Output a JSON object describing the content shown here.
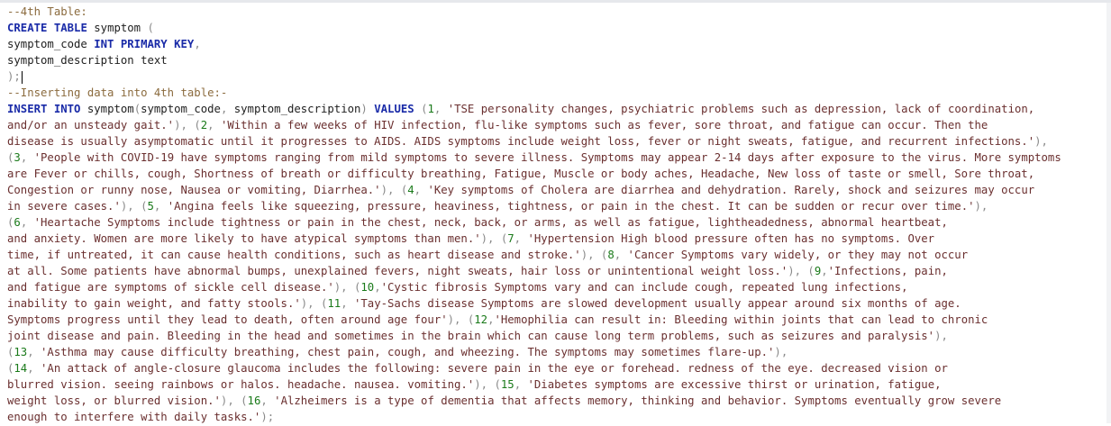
{
  "editor": {
    "lines": [
      "--4th Table:",
      "CREATE TABLE symptom (",
      "symptom_code INT PRIMARY KEY,",
      "symptom_description text",
      ");",
      "--Inserting data into 4th table:-",
      "INSERT INTO symptom(symptom_code, symptom_description) VALUES (1, 'TSE personality changes, psychiatric problems such as depression, lack of coordination,",
      "and/or an unsteady gait.'), (2, 'Within a few weeks of HIV infection, flu-like symptoms such as fever, sore throat, and fatigue can occur. Then the",
      "disease is usually asymptomatic until it progresses to AIDS. AIDS symptoms include weight loss, fever or night sweats, fatigue, and recurrent infections.'),",
      "(3, 'People with COVID-19 have symptoms ranging from mild symptoms to severe illness. Symptoms may appear 2-14 days after exposure to the virus. More symptoms",
      "are Fever or chills, cough, Shortness of breath or difficulty breathing, Fatigue, Muscle or body aches, Headache, New loss of taste or smell, Sore throat,",
      "Congestion or runny nose, Nausea or vomiting, Diarrhea.'), (4, 'Key symptoms of Cholera are diarrhea and dehydration. Rarely, shock and seizures may occur",
      "in severe cases.'), (5, 'Angina feels like squeezing, pressure, heaviness, tightness, or pain in the chest. It can be sudden or recur over time.'),",
      "(6, 'Heartache Symptoms include tightness or pain in the chest, neck, back, or arms, as well as fatigue, lightheadedness, abnormal heartbeat,",
      "and anxiety. Women are more likely to have atypical symptoms than men.'), (7, 'Hypertension High blood pressure often has no symptoms. Over",
      "time, if untreated, it can cause health conditions, such as heart disease and stroke.'), (8, 'Cancer Symptoms vary widely, or they may not occur",
      "at all. Some patients have abnormal bumps, unexplained fevers, night sweats, hair loss or unintentional weight loss.'), (9,'Infections, pain,",
      "and fatigue are symptoms of sickle cell disease.'), (10,'Cystic fibrosis Symptoms vary and can include cough, repeated lung infections,",
      "inability to gain weight, and fatty stools.'), (11, 'Tay-Sachs disease Symptoms are slowed development usually appear around six months of age.",
      "Symptoms progress until they lead to death, often around age four'), (12,'Hemophilia can result in: Bleeding within joints that can lead to chronic",
      "joint disease and pain. Bleeding in the head and sometimes in the brain which can cause long term problems, such as seizures and paralysis'),",
      "(13, 'Asthma may cause difficulty breathing, chest pain, cough, and wheezing. The symptoms may sometimes flare-up.'),",
      "(14, 'An attack of angle-closure glaucoma includes the following: severe pain in the eye or forehead. redness of the eye. decreased vision or",
      "blurred vision. seeing rainbows or halos. headache. nausea. vomiting.'), (15, 'Diabetes symptoms are excessive thirst or urination, fatigue,",
      "weight loss, or blurred vision.'), (16, 'Alzheimers is a type of dementia that affects memory, thinking and behavior. Symptoms eventually grow severe",
      "enough to interfere with daily tasks.');"
    ]
  }
}
